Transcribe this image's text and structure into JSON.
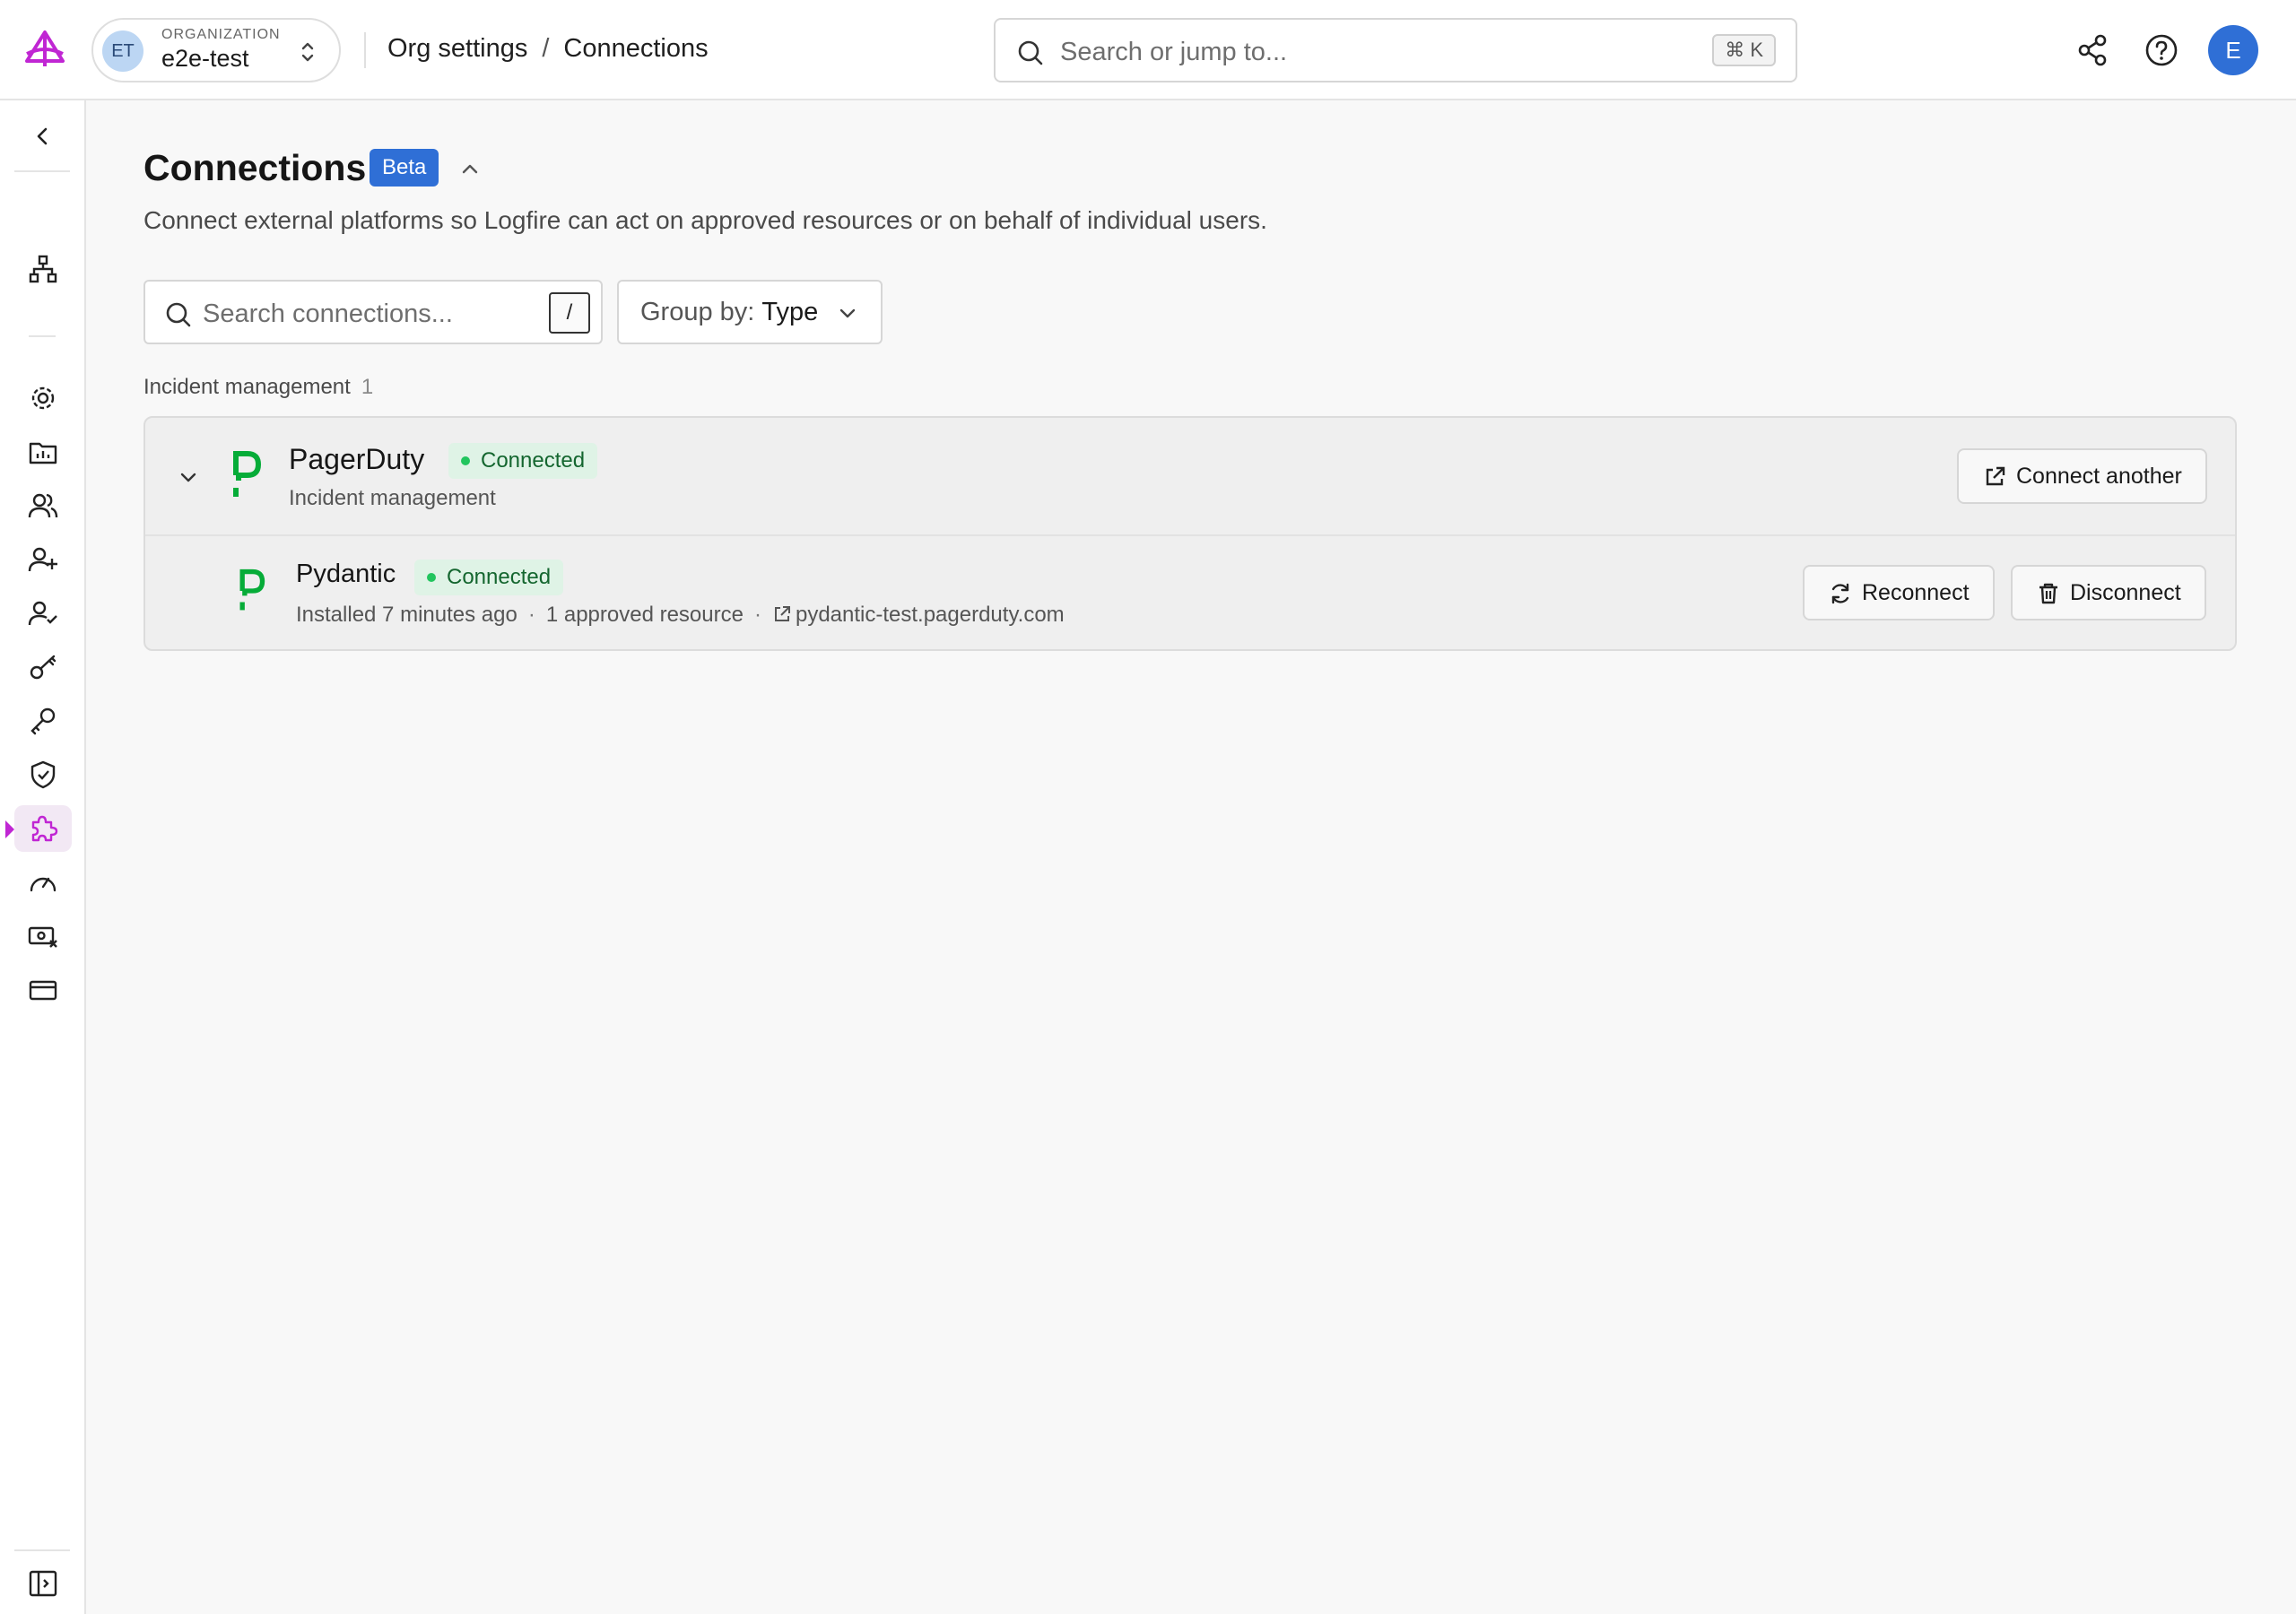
{
  "org": {
    "avatar_initials": "ET",
    "label": "ORGANIZATION",
    "name": "e2e-test"
  },
  "breadcrumb": {
    "parent": "Org settings",
    "separator": "/",
    "current": "Connections"
  },
  "global_search": {
    "placeholder": "Search or jump to...",
    "shortcut": "⌘ K"
  },
  "user": {
    "avatar_initial": "E"
  },
  "header_icons": [
    "share-icon",
    "help-icon"
  ],
  "sidebar": {
    "items": [
      {
        "name": "collapse-sidebar",
        "icon": "chevron-left-icon"
      },
      {
        "name": "hierarchy",
        "icon": "hierarchy-icon"
      },
      {
        "name": "settings",
        "icon": "gear-icon"
      },
      {
        "name": "projects",
        "icon": "folder-chart-icon"
      },
      {
        "name": "members",
        "icon": "users-icon"
      },
      {
        "name": "invite",
        "icon": "user-plus-icon"
      },
      {
        "name": "roles",
        "icon": "user-check-icon"
      },
      {
        "name": "api-keys",
        "icon": "key-icon"
      },
      {
        "name": "tokens",
        "icon": "wrench-key-icon"
      },
      {
        "name": "security",
        "icon": "shield-check-icon"
      },
      {
        "name": "connections",
        "icon": "puzzle-icon",
        "active": true
      },
      {
        "name": "usage",
        "icon": "gauge-icon"
      },
      {
        "name": "spending",
        "icon": "money-x-icon"
      },
      {
        "name": "billing",
        "icon": "credit-card-icon"
      },
      {
        "name": "toggle-panel",
        "icon": "panel-toggle-icon"
      }
    ],
    "accent_color": "#c026d3"
  },
  "page": {
    "title": "Connections",
    "badge": "Beta",
    "description": "Connect external platforms so Logfire can act on approved resources or on behalf of individual users."
  },
  "filters": {
    "search_placeholder": "Search connections...",
    "search_shortcut": "/",
    "group_by_label": "Group by:",
    "group_by_value": "Type"
  },
  "groups": [
    {
      "heading": "Incident management",
      "count": "1",
      "connection": {
        "name": "PagerDuty",
        "status": "Connected",
        "type": "Incident management",
        "action": "Connect another",
        "installations": [
          {
            "name": "Pydantic",
            "status": "Connected",
            "installed": "Installed 7 minutes ago",
            "resources": "1 approved resource",
            "domain": "pydantic-test.pagerduty.com",
            "actions": [
              "Reconnect",
              "Disconnect"
            ]
          }
        ]
      }
    }
  ],
  "colors": {
    "brand_accent": "#c026d3",
    "badge_blue": "#2f6fd6",
    "status_green": "#22c55e",
    "pagerduty_green": "#06ac38"
  }
}
